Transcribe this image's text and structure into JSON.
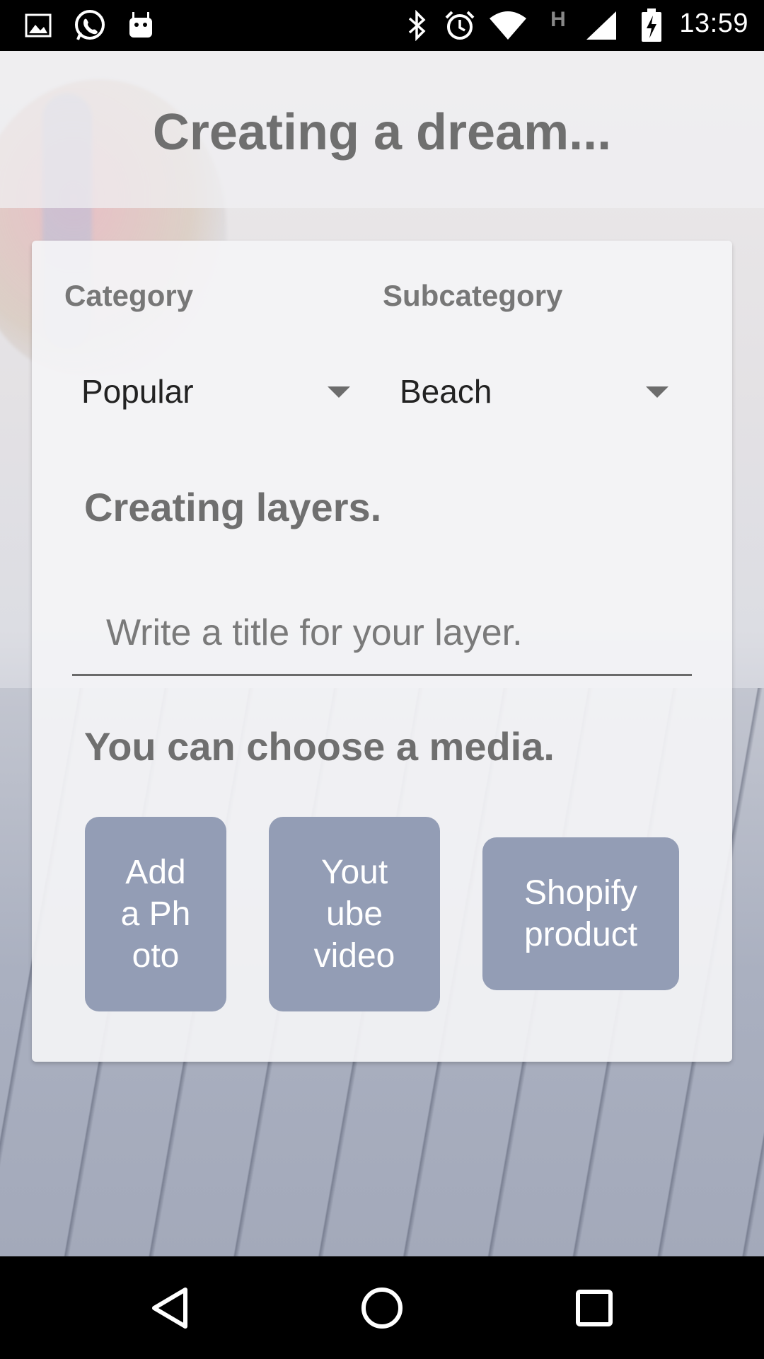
{
  "status_bar": {
    "time": "13:59",
    "left_icons": [
      "gallery-icon",
      "whatsapp-icon",
      "android-icon"
    ],
    "right_icons": [
      "bluetooth-icon",
      "alarm-icon",
      "wifi-icon",
      "h-network-icon",
      "signal-icon",
      "battery-charging-icon"
    ],
    "network_type": "H"
  },
  "header": {
    "title": "Creating a dream..."
  },
  "form": {
    "category": {
      "label": "Category",
      "value": "Popular"
    },
    "subcategory": {
      "label": "Subcategory",
      "value": "Beach"
    },
    "layers_heading": "Creating layers.",
    "title_input": {
      "placeholder": "Write a title for your layer.",
      "value": ""
    },
    "media_heading": "You can choose a media.",
    "media_buttons": [
      {
        "lines": [
          "Add",
          "a Ph",
          "oto"
        ]
      },
      {
        "lines": [
          "Yout",
          "ube",
          "video"
        ]
      },
      {
        "lines": [
          "Shopify",
          "product"
        ]
      }
    ]
  },
  "colors": {
    "button_bg": "#939db5",
    "heading_text": "#6f6f6f",
    "card_bg": "#f4f4f6"
  },
  "nav_bar": {
    "icons": [
      "back-icon",
      "home-icon",
      "recents-icon"
    ]
  }
}
